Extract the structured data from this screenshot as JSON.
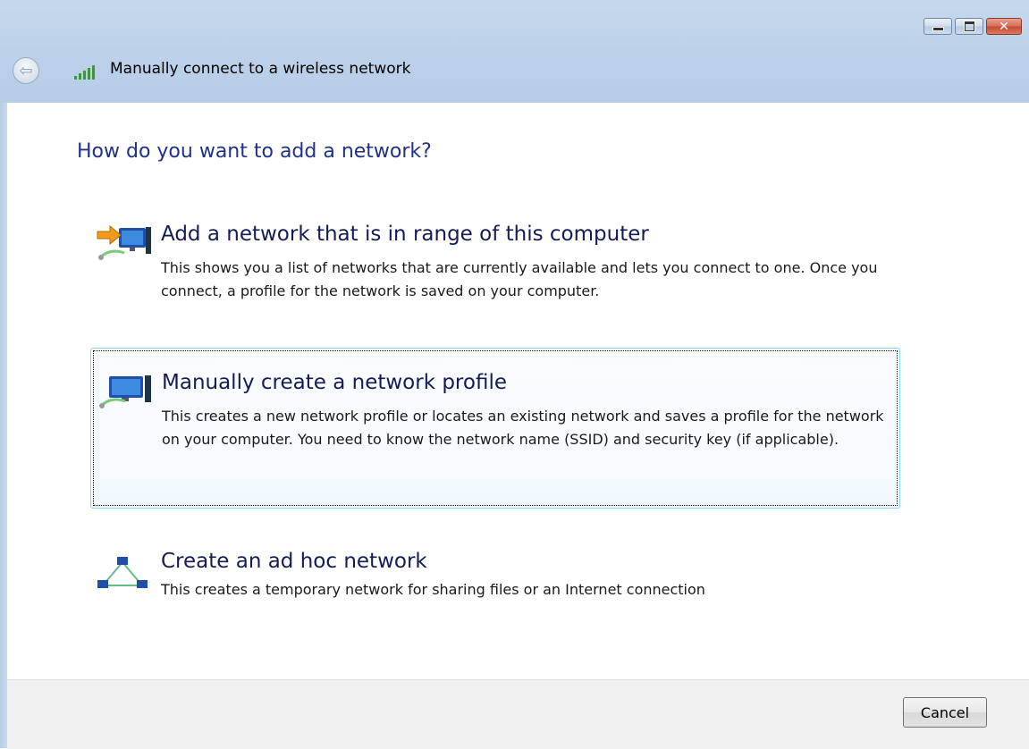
{
  "window": {
    "title": "Manually connect to a wireless network",
    "controls": [
      "minimize-icon",
      "maximize-icon",
      "close-icon"
    ]
  },
  "heading": "How do you want to add a network?",
  "options": [
    {
      "title": "Add a network that is in range of this computer",
      "description": "This shows you a list of networks that are currently available and lets you connect to one. Once you connect, a profile for the network is saved on your computer.",
      "icon": "network-in-range-icon"
    },
    {
      "title": "Manually create a network profile",
      "description": "This creates a new network profile or locates an existing network and saves a profile for the network on your computer. You need to know the network name (SSID) and security key (if applicable).",
      "icon": "network-profile-icon",
      "focused": true
    },
    {
      "title": "Create an ad hoc network",
      "description": "This creates a temporary network for sharing files or an Internet connection",
      "icon": "ad-hoc-network-icon"
    }
  ],
  "footer": {
    "cancel_label": "Cancel"
  },
  "colors": {
    "heading": "#1e3287",
    "option_title": "#151c55",
    "focus_border": "#8fd3f1",
    "titlebar": "#bed3ea"
  }
}
